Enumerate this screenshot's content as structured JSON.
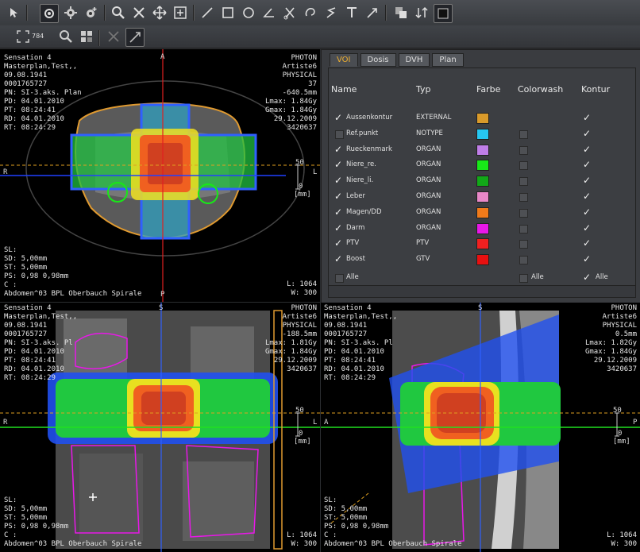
{
  "toolbar": {
    "icons": [
      "arrow-pointer-icon",
      "eye-icon",
      "gear-icon",
      "gear-plus-icon",
      "zoom-icon",
      "cross-arrows-icon",
      "pan-icon",
      "window-level-icon",
      "line-icon",
      "rectangle-icon",
      "circle-icon",
      "angle-icon",
      "scissors-icon",
      "freehand-icon",
      "polyline-icon",
      "text-icon",
      "arrow-annotation-icon",
      "copy-icon",
      "sort-icon",
      "dark-icon"
    ],
    "zoom_label": "784",
    "row2_icons": [
      "fit-icon",
      "magnify-icon",
      "grid-icon",
      "crosshair-disabled-icon",
      "crosshair-icon"
    ]
  },
  "views": {
    "axial": {
      "tl": [
        "Sensation 4",
        "Masterplan,Test,,",
        "09.08.1941",
        "0001765727",
        "PN: SI-3.aks. Plan",
        "PD: 04.01.2010",
        "PT: 08:24:41",
        "RD: 04.01.2010",
        "RT: 08:24:29"
      ],
      "tr": [
        "PHOTON",
        "Artiste6",
        "PHYSICAL",
        "37",
        "-640.5mm",
        "Lmax: 1.84Gy",
        "Gmax: 1.84Gy",
        "",
        "29.12.2009",
        "",
        "3420637"
      ],
      "bl": [
        "SL:",
        "SD: 5,00mm",
        "ST: 5,00mm",
        "PS: 0,98 0,98mm",
        "C :",
        "Abdomen^03 BPL Oberbauch Spirale"
      ],
      "br": [
        "L: 1064",
        "W: 300"
      ],
      "orient_top": "A",
      "orient_left": "R",
      "orient_right": "L",
      "orient_bottom": "P",
      "scale_top": "50",
      "scale_mid": "0",
      "scale_unit": "[mm]"
    },
    "coronal": {
      "tl": [
        "Sensation 4",
        "Masterplan,Test,,",
        "09.08.1941",
        "0001765727",
        "PN: SI-3.aks. Pl",
        "PD: 04.01.2010",
        "PT: 08:24:41",
        "RD: 04.01.2010",
        "RT: 08:24:29"
      ],
      "tr": [
        "PHOTON",
        "Artiste6",
        "PHYSICAL",
        "-188.5mm",
        "Lmax: 1.81Gy",
        "Gmax: 1.84Gy",
        "",
        "29.12.2009",
        "",
        "3420637"
      ],
      "bl": [
        "SL:",
        "SD: 5,00mm",
        "ST: 5,00mm",
        "PS: 0,98 0,98mm",
        "C :",
        "Abdomen^03 BPL Oberbauch Spirale"
      ],
      "br": [
        "L: 1064",
        "W: 300"
      ],
      "orient_top": "S",
      "orient_left": "R",
      "orient_right": "L",
      "scale_top": "50",
      "scale_mid": "0",
      "scale_unit": "[mm]"
    },
    "sagittal": {
      "tl": [
        "Sensation 4",
        "Masterplan,Test,,",
        "09.08.1941",
        "0001765727",
        "PN: SI-3.aks. Pl",
        "PD: 04.01.2010",
        "PT: 08:24:41",
        "RD: 04.01.2010",
        "RT: 08:24:29"
      ],
      "tr": [
        "PHOTON",
        "Artiste6",
        "PHYSICAL",
        "0.5mm",
        "Lmax: 1.82Gy",
        "Gmax: 1.84Gy",
        "",
        "29.12.2009",
        "",
        "3420637"
      ],
      "bl": [
        "SL:",
        "SD: 5,00mm",
        "ST: 5,00mm",
        "PS: 0,98 0,98mm",
        "C :",
        "Abdomen^03 BPL Oberbauch Spirale"
      ],
      "br": [
        "L: 1064",
        "W: 300"
      ],
      "orient_top": "S",
      "orient_left": "A",
      "orient_right": "P",
      "scale_top": "50",
      "scale_mid": "0",
      "scale_unit": "[mm]"
    }
  },
  "panel": {
    "tabs": [
      "VOI",
      "Dosis",
      "DVH",
      "Plan"
    ],
    "active_tab": "VOI",
    "headers": {
      "name": "Name",
      "typ": "Typ",
      "farbe": "Farbe",
      "colorwash": "Colorwash",
      "kontur": "Kontur"
    },
    "rows": [
      {
        "checked": true,
        "name": "Aussenkontur",
        "typ": "EXTERNAL",
        "color": "#d99a2a",
        "kontur": true,
        "colorwash": false
      },
      {
        "checked": false,
        "name": "Ref.punkt",
        "typ": "NOTYPE",
        "color": "#26c6f0",
        "kontur": true,
        "colorwash": true
      },
      {
        "checked": true,
        "name": "Rueckenmark",
        "typ": "ORGAN",
        "color": "#c07ee8",
        "kontur": true,
        "colorwash": true
      },
      {
        "checked": true,
        "name": "Niere_re.",
        "typ": "ORGAN",
        "color": "#18e818",
        "kontur": true,
        "colorwash": true
      },
      {
        "checked": true,
        "name": "Niere_li.",
        "typ": "ORGAN",
        "color": "#12a818",
        "kontur": true,
        "colorwash": true
      },
      {
        "checked": true,
        "name": "Leber",
        "typ": "ORGAN",
        "color": "#e888c8",
        "kontur": true,
        "colorwash": true
      },
      {
        "checked": true,
        "name": "Magen/DD",
        "typ": "ORGAN",
        "color": "#f07a1a",
        "kontur": true,
        "colorwash": true
      },
      {
        "checked": true,
        "name": "Darm",
        "typ": "ORGAN",
        "color": "#e818e8",
        "kontur": true,
        "colorwash": true
      },
      {
        "checked": true,
        "name": "PTV",
        "typ": "PTV",
        "color": "#f02020",
        "kontur": true,
        "colorwash": true
      },
      {
        "checked": true,
        "name": "Boost",
        "typ": "GTV",
        "color": "#e81010",
        "kontur": true,
        "colorwash": true
      }
    ],
    "all_row": {
      "name": "Alle",
      "colorwash_label": "Alle",
      "kontur_label": "Alle"
    }
  }
}
